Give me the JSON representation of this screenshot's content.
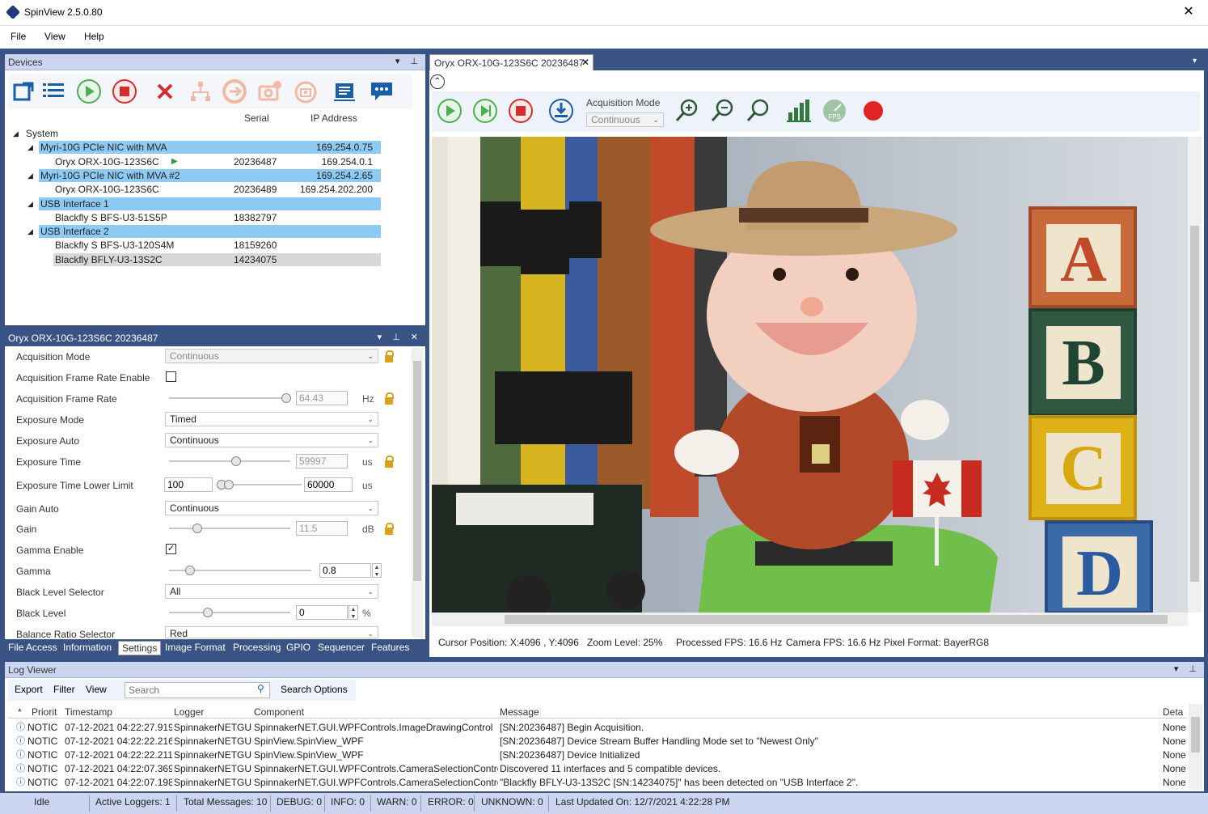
{
  "app": {
    "title": "SpinView 2.5.0.80",
    "close": "✕"
  },
  "menu": [
    "File",
    "View",
    "Help"
  ],
  "devices": {
    "title": "Devices",
    "col_serial": "Serial",
    "col_ip": "IP Address",
    "rows": [
      {
        "name": "System",
        "serial": "",
        "ip": "",
        "level": 0,
        "style": ""
      },
      {
        "name": "Myri-10G PCIe NIC with MVA",
        "serial": "",
        "ip": "169.254.0.75",
        "level": 1,
        "style": "hi"
      },
      {
        "name": "Oryx ORX-10G-123S6C",
        "serial": "20236487",
        "ip": "169.254.0.1",
        "level": 2,
        "style": "",
        "playing": true
      },
      {
        "name": "Myri-10G PCIe NIC with MVA #2",
        "serial": "",
        "ip": "169.254.2.65",
        "level": 1,
        "style": "hi"
      },
      {
        "name": "Oryx ORX-10G-123S6C",
        "serial": "20236489",
        "ip": "169.254.202.200",
        "level": 2,
        "style": ""
      },
      {
        "name": "USB Interface 1",
        "serial": "",
        "ip": "",
        "level": 1,
        "style": "hi"
      },
      {
        "name": "Blackfly S BFS-U3-51S5P",
        "serial": "18382797",
        "ip": "",
        "level": 2,
        "style": ""
      },
      {
        "name": "USB Interface 2",
        "serial": "",
        "ip": "",
        "level": 1,
        "style": "hi"
      },
      {
        "name": "Blackfly S BFS-U3-120S4M",
        "serial": "18159260",
        "ip": "",
        "level": 2,
        "style": ""
      },
      {
        "name": "Blackfly BFLY-U3-13S2C",
        "serial": "14234075",
        "ip": "",
        "level": 2,
        "style": "sel"
      }
    ]
  },
  "props": {
    "title": "Oryx ORX-10G-123S6C 20236487",
    "acq_mode_label": "Acquisition Mode",
    "acq_mode": "Continuous",
    "afr_enable_label": "Acquisition Frame Rate Enable",
    "afr_label": "Acquisition Frame Rate",
    "afr_value": "64.43",
    "afr_unit": "Hz",
    "exp_mode_label": "Exposure Mode",
    "exp_mode": "Timed",
    "exp_auto_label": "Exposure Auto",
    "exp_auto": "Continuous",
    "exp_time_label": "Exposure Time",
    "exp_time": "59997",
    "exp_time_unit": "us",
    "exp_lower_label": "Exposure Time Lower Limit",
    "exp_lower_min": "100",
    "exp_lower_max": "60000",
    "exp_lower_unit": "us",
    "gain_auto_label": "Gain Auto",
    "gain_auto": "Continuous",
    "gain_label": "Gain",
    "gain": "11.5",
    "gain_unit": "dB",
    "gamma_en_label": "Gamma Enable",
    "gamma_en_check": "✓",
    "gamma_label": "Gamma",
    "gamma": "0.8",
    "bls_label": "Black Level Selector",
    "bls": "All",
    "bl_label": "Black Level",
    "bl": "0",
    "bl_unit": "%",
    "brs_label": "Balance Ratio Selector",
    "brs": "Red",
    "tabs": [
      "File Access",
      "Information",
      "Settings",
      "Image Format",
      "Processing",
      "GPIO",
      "Sequencer",
      "Features"
    ]
  },
  "viewer": {
    "tab_title": "Oryx ORX-10G-123S6C 20236487",
    "acq_mode_label": "Acquisition Mode",
    "acq_mode": "Continuous",
    "fps_icon_text": "FPS",
    "status": {
      "cursor": "Cursor Position: X:4096 , Y:4096",
      "zoom": "Zoom Level: 25%",
      "proc_fps": "Processed FPS: 16.6 Hz",
      "cam_fps": "Camera FPS: 16.6 Hz",
      "pixfmt": "Pixel Format: BayerRG8"
    },
    "blocks": [
      "A",
      "B",
      "C",
      "D"
    ]
  },
  "log": {
    "title": "Log Viewer",
    "toolbar": [
      "Export",
      "Filter",
      "View"
    ],
    "search_placeholder": "Search",
    "search_options": "Search Options",
    "columns": [
      "*",
      "Priorit",
      "Timestamp",
      "Logger",
      "Component",
      "Message",
      "Deta"
    ],
    "rows": [
      [
        "NOTIC",
        "07-12-2021 04:22:27.919",
        "SpinnakerNETGUI",
        "SpinnakerNET.GUI.WPFControls.ImageDrawingControl",
        "[SN:20236487] Begin Acquisition.",
        "None"
      ],
      [
        "NOTIC",
        "07-12-2021 04:22:22.216",
        "SpinnakerNETGUI",
        "SpinView.SpinView_WPF",
        "[SN:20236487] Device Stream Buffer Handling Mode set to \"Newest Only\"",
        "None"
      ],
      [
        "NOTIC",
        "07-12-2021 04:22:22.211",
        "SpinnakerNETGUI",
        "SpinView.SpinView_WPF",
        "[SN:20236487] Device Initialized",
        "None"
      ],
      [
        "NOTIC",
        "07-12-2021 04:22:07.369",
        "SpinnakerNETGUI",
        "SpinnakerNET.GUI.WPFControls.CameraSelectionControl",
        "Discovered 11 interfaces and 5 compatible devices.",
        "None"
      ],
      [
        "NOTIC",
        "07-12-2021 04:22:07.198",
        "SpinnakerNETGUI",
        "SpinnakerNET.GUI.WPFControls.CameraSelectionControl",
        "\"Blackfly BFLY-U3-13S2C [SN:14234075]\" has been detected on \"USB Interface 2\".",
        "None"
      ]
    ]
  },
  "statusbar": [
    "Idle",
    "Active Loggers: 1",
    "Total Messages: 10",
    "DEBUG: 0",
    "INFO: 0",
    "WARN: 0",
    "ERROR: 0",
    "UNKNOWN: 0",
    "Last Updated On: 12/7/2021 4:22:28 PM"
  ]
}
